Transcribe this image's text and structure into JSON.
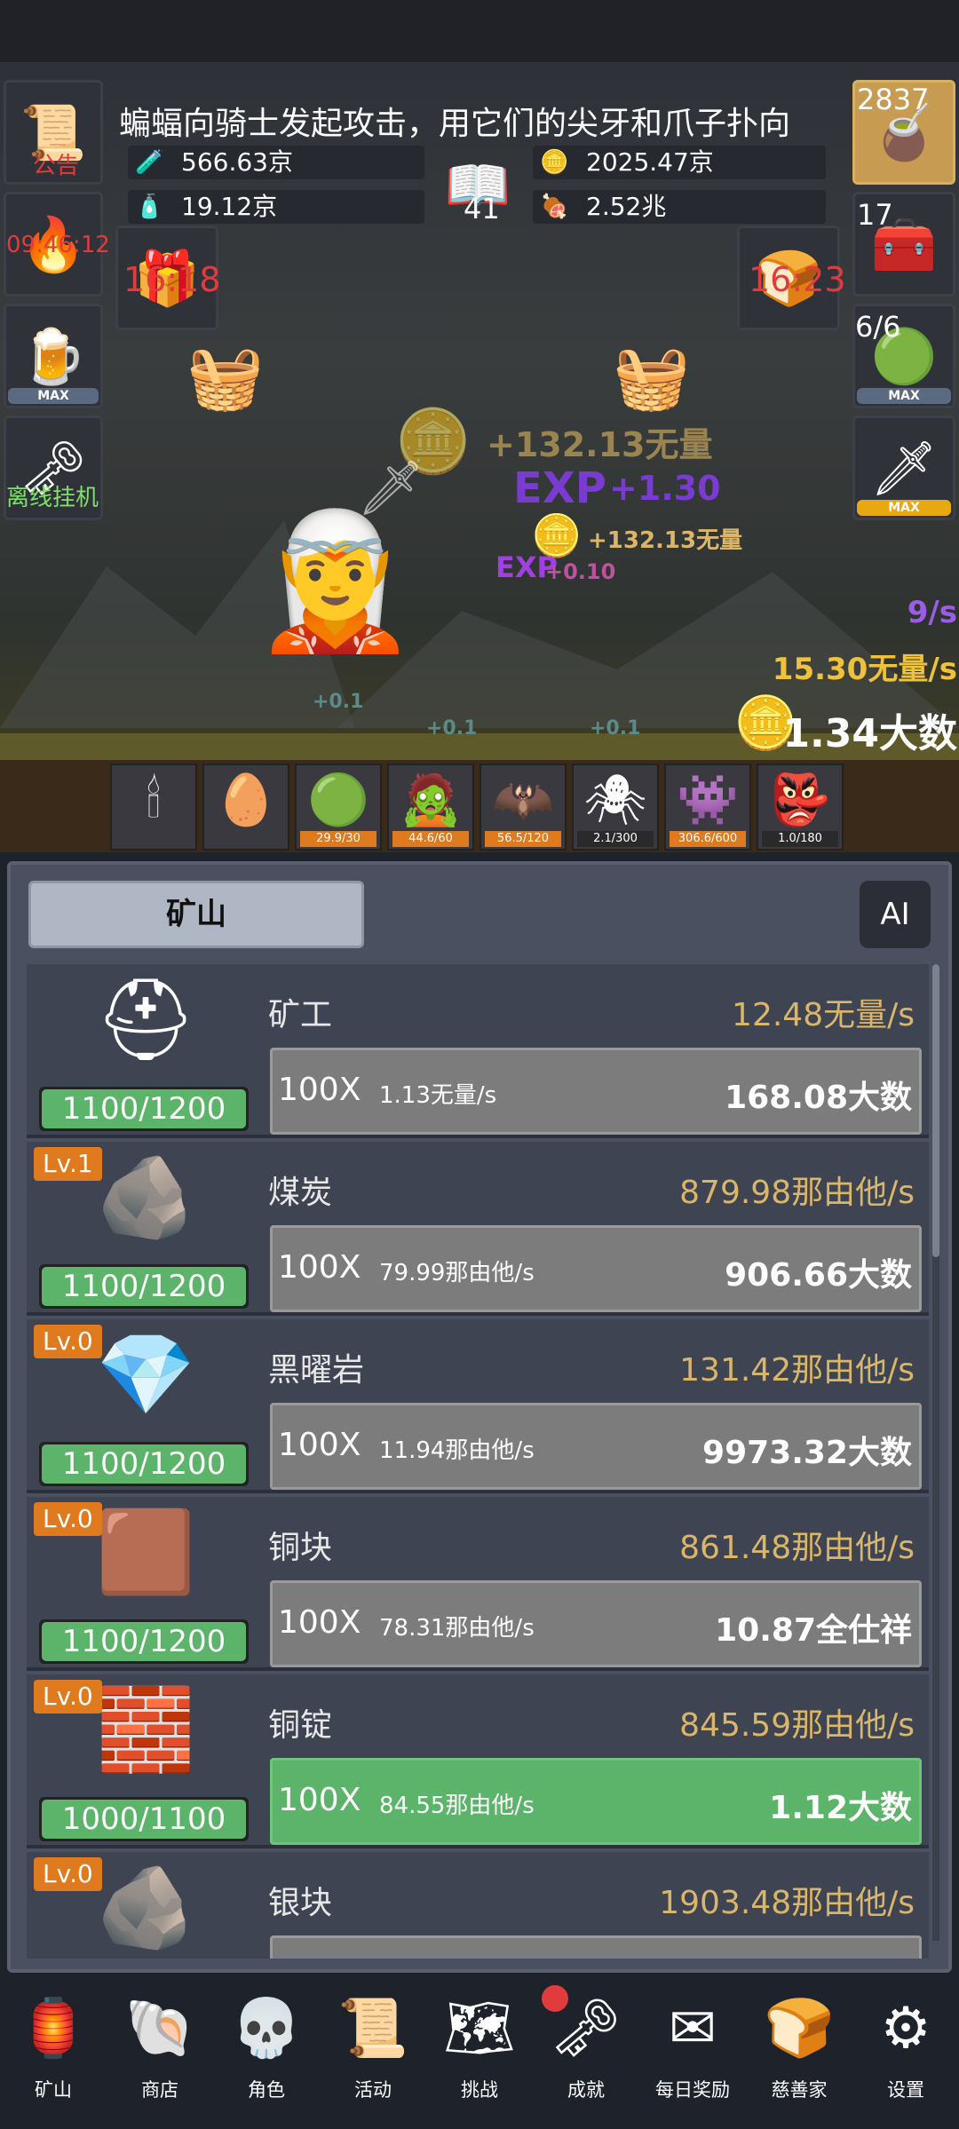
{
  "header": {
    "message": "蝙蝠向骑士发起攻击，用它们的尖牙和爪子扑向",
    "notice_label": "公告",
    "timer_torch": "09:46:12",
    "offline_label": "离线挂机",
    "max_label": "MAX",
    "potion_count": "2837",
    "chest_count": "17",
    "slime_count": "6/6",
    "book_count": "41",
    "left_chest_timer": "16:18",
    "right_chest_timer": "16:23"
  },
  "resources": {
    "blue_potion": "566.63京",
    "green_potion": "19.12京",
    "coin_stack": "2025.47京",
    "meat": "2.52兆"
  },
  "battle": {
    "float_1": "+132.13无量",
    "float_2": "+1.30",
    "float_3": "+132.13无量",
    "float_4": "+0.10",
    "float_5": "+0.1",
    "float_6": "+0.1",
    "float_7": "+0.1",
    "exp_label": "EXP",
    "per_sec": "9/s",
    "gold_rate": "15.30无量/s",
    "gold_total": "1.34大数"
  },
  "monsters": [
    {
      "icon": "candle-icon",
      "glyph": "🕯",
      "count": ""
    },
    {
      "icon": "egg-icon",
      "glyph": "🥚",
      "count": ""
    },
    {
      "icon": "slime-icon",
      "glyph": "🟢",
      "count": "29.9/30",
      "orange": true
    },
    {
      "icon": "zombie-icon",
      "glyph": "🧟",
      "count": "44.6/60",
      "orange": true
    },
    {
      "icon": "bat-icon",
      "glyph": "🦇",
      "count": "56.5/120",
      "orange": true
    },
    {
      "icon": "spider-icon",
      "glyph": "🕷",
      "count": "2.1/300",
      "orange": false
    },
    {
      "icon": "ghoul-icon",
      "glyph": "👾",
      "count": "306.6/600",
      "orange": true
    },
    {
      "icon": "goblin-icon",
      "glyph": "👺",
      "count": "1.0/180",
      "orange": false
    }
  ],
  "panel": {
    "tab_label": "矿山",
    "ai_label": "AI",
    "buy_multiplier": "100X",
    "rows": [
      {
        "icon": "miner-icon",
        "glyph": "⛑",
        "level": "",
        "hp": "1100/1200",
        "hp_ratio": 0.917,
        "name": "矿工",
        "rate": "12.48无量/s",
        "increment": "1.13无量/s",
        "cost": "168.08大数",
        "affordable": false
      },
      {
        "icon": "coal-icon",
        "glyph": "🪨",
        "level": "Lv.1",
        "hp": "1100/1200",
        "hp_ratio": 0.917,
        "name": "煤炭",
        "rate": "879.98那由他/s",
        "increment": "79.99那由他/s",
        "cost": "906.66大数",
        "affordable": false
      },
      {
        "icon": "obsidian-icon",
        "glyph": "💎",
        "level": "Lv.0",
        "hp": "1100/1200",
        "hp_ratio": 0.917,
        "name": "黑曜岩",
        "rate": "131.42那由他/s",
        "increment": "11.94那由他/s",
        "cost": "9973.32大数",
        "affordable": false
      },
      {
        "icon": "copper-ore-icon",
        "glyph": "🟫",
        "level": "Lv.0",
        "hp": "1100/1200",
        "hp_ratio": 0.917,
        "name": "铜块",
        "rate": "861.48那由他/s",
        "increment": "78.31那由他/s",
        "cost": "10.87全仕祥",
        "affordable": false
      },
      {
        "icon": "copper-ingot-icon",
        "glyph": "🧱",
        "level": "Lv.0",
        "hp": "1000/1100",
        "hp_ratio": 0.909,
        "name": "铜锭",
        "rate": "845.59那由他/s",
        "increment": "84.55那由他/s",
        "cost": "1.12大数",
        "affordable": true
      },
      {
        "icon": "silver-ore-icon",
        "glyph": "🪨",
        "level": "Lv.0",
        "hp": "",
        "hp_ratio": 0,
        "name": "银块",
        "rate": "1903.48那由他/s",
        "increment": "",
        "cost": "",
        "affordable": false
      }
    ]
  },
  "nav": [
    {
      "name": "nav-mine",
      "icon": "lantern-icon",
      "glyph": "🏮",
      "label": "矿山"
    },
    {
      "name": "nav-shop",
      "icon": "shell-icon",
      "glyph": "🐚",
      "label": "商店"
    },
    {
      "name": "nav-character",
      "icon": "skull-icon",
      "glyph": "💀",
      "label": "角色"
    },
    {
      "name": "nav-events",
      "icon": "scroll-icon",
      "glyph": "📜",
      "label": "活动"
    },
    {
      "name": "nav-challenge",
      "icon": "map-icon",
      "glyph": "🗺",
      "label": "挑战"
    },
    {
      "name": "nav-achievements",
      "icon": "key-icon",
      "glyph": "🗝",
      "label": "成就"
    },
    {
      "name": "nav-daily-reward",
      "icon": "envelope-icon",
      "glyph": "✉",
      "label": "每日奖励"
    },
    {
      "name": "nav-philanthropist",
      "icon": "bread-icon",
      "glyph": "🍞",
      "label": "慈善家"
    },
    {
      "name": "nav-settings",
      "icon": "gear-icon",
      "glyph": "⚙",
      "label": "设置"
    }
  ],
  "colors": {
    "accent_green": "#5cb36a",
    "level_orange": "#e07a1e",
    "rate_gold": "#d9b66a",
    "notice_red": "#e23b3b"
  }
}
